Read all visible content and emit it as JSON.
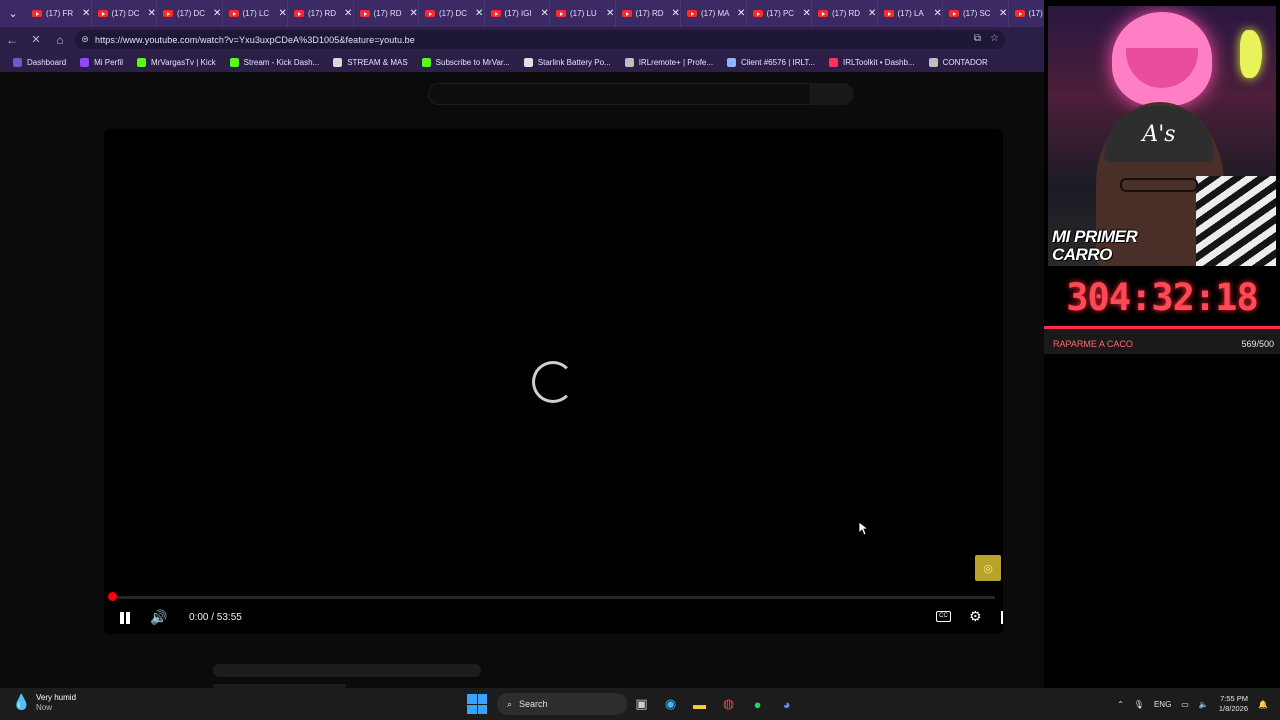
{
  "browser": {
    "tabs": [
      {
        "title": "(17) FR"
      },
      {
        "title": "(17) DC"
      },
      {
        "title": "(17) DC"
      },
      {
        "title": "(17) LC"
      },
      {
        "title": "(17) RD"
      },
      {
        "title": "(17) RD"
      },
      {
        "title": "(17) DC"
      },
      {
        "title": "(17) IGI"
      },
      {
        "title": "(17) LU"
      },
      {
        "title": "(17) RD"
      },
      {
        "title": "(17) MA"
      },
      {
        "title": "(17) PC"
      },
      {
        "title": "(17) RD"
      },
      {
        "title": "(17) LA"
      },
      {
        "title": "(17) SC"
      },
      {
        "title": "(17)"
      }
    ],
    "url": "https://www.youtube.com/watch?v=Yxu3uxpCDeA%3D1005&feature=youtu.be",
    "bookmarks": [
      {
        "label": "Dashboard",
        "color": "#6a5acd"
      },
      {
        "label": "Mi Perfil",
        "color": "#9146ff"
      },
      {
        "label": "MrVargasTv | Kick",
        "color": "#53fc18"
      },
      {
        "label": "Stream - Kick Dash...",
        "color": "#53fc18"
      },
      {
        "label": "STREAM & MAS",
        "color": "#d8d8d8"
      },
      {
        "label": "Subscribe to MrVar...",
        "color": "#53fc18"
      },
      {
        "label": "Starlink Battery Po...",
        "color": "#e0e0e0"
      },
      {
        "label": "IRLremote+ | Profe...",
        "color": "#bdbdbd"
      },
      {
        "label": "Client #6576 | IRLT...",
        "color": "#8fb3ff"
      },
      {
        "label": "IRLToolkit • Dashb...",
        "color": "#ff3355"
      },
      {
        "label": "CONTADOR",
        "color": "#bdbdbd"
      }
    ]
  },
  "player": {
    "time": "0:00 / 53:55",
    "progress": 0.0,
    "cc_label": "CC",
    "spinner_icon": "loading-spinner"
  },
  "overlay": {
    "banner": "MI PRIMER CARRO",
    "timer": "304:32:18",
    "goal_label": "RAPARME A CACO",
    "goal_count": "569/500",
    "accent": "#ff2e45"
  },
  "taskbar": {
    "weather_text": "Very humid",
    "weather_sub": "Now",
    "search_label": "Search",
    "lang": "ENG",
    "time": "7:55 PM",
    "date": "1/8/2026"
  }
}
